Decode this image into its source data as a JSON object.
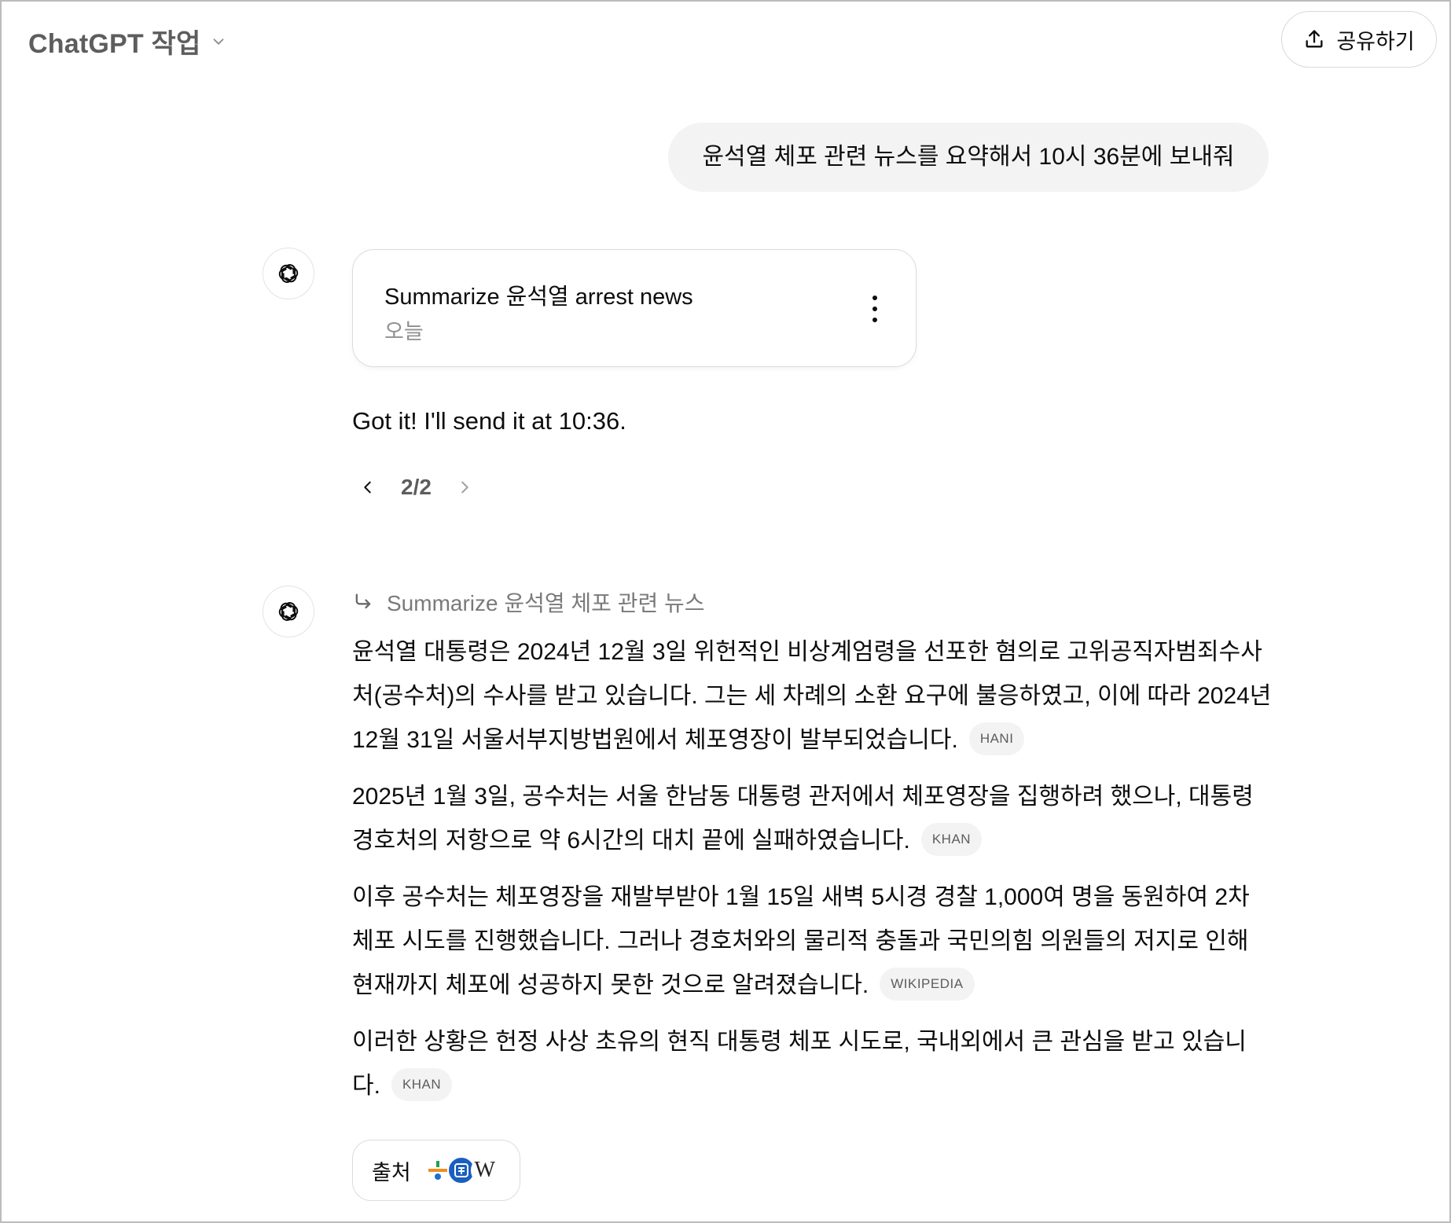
{
  "header": {
    "model_title": "ChatGPT 작업",
    "share_label": "공유하기"
  },
  "user_message": "윤석열 체포 관련 뉴스를 요약해서 10시 36분에 보내줘",
  "task_card": {
    "title": "Summarize 윤석열 arrest news",
    "date": "오늘"
  },
  "reply": {
    "text": "Got it! I'll send it at 10:36.",
    "pager": "2/2"
  },
  "task_reference": "Summarize 윤석열 체포 관련 뉴스",
  "answer": {
    "paragraphs": [
      {
        "text": "윤석열 대통령은 2024년 12월 3일 위헌적인 비상계엄령을 선포한 혐의로 고위공직자범죄수사처(공수처)의 수사를 받고 있습니다. 그는 세 차례의 소환 요구에 불응하였고, 이에 따라 2024년 12월 31일 서울서부지방법원에서 체포영장이 발부되었습니다.",
        "citation": "HANI"
      },
      {
        "text": "2025년 1월 3일, 공수처는 서울 한남동 대통령 관저에서 체포영장을 집행하려 했으나, 대통령 경호처의 저항으로 약 6시간의 대치 끝에 실패하였습니다.",
        "citation": "KHAN"
      },
      {
        "text": "이후 공수처는 체포영장을 재발부받아 1월 15일 새벽 5시경 경찰 1,000여 명을 동원하여 2차 체포 시도를 진행했습니다. 그러나 경호처와의 물리적 충돌과 국민의힘 의원들의 저지로 인해 현재까지 체포에 성공하지 못한 것으로 알려졌습니다.",
        "citation": "WIKIPEDIA"
      },
      {
        "text": "이러한 상황은 헌정 사상 초유의 현직 대통령 체포 시도로, 국내외에서 큰 관심을 받고 있습니다.",
        "citation": "KHAN"
      }
    ]
  },
  "sources": {
    "label": "출처",
    "icons": [
      "hani-icon",
      "khan-icon",
      "wikipedia-icon"
    ],
    "wiki_glyph": "W"
  }
}
